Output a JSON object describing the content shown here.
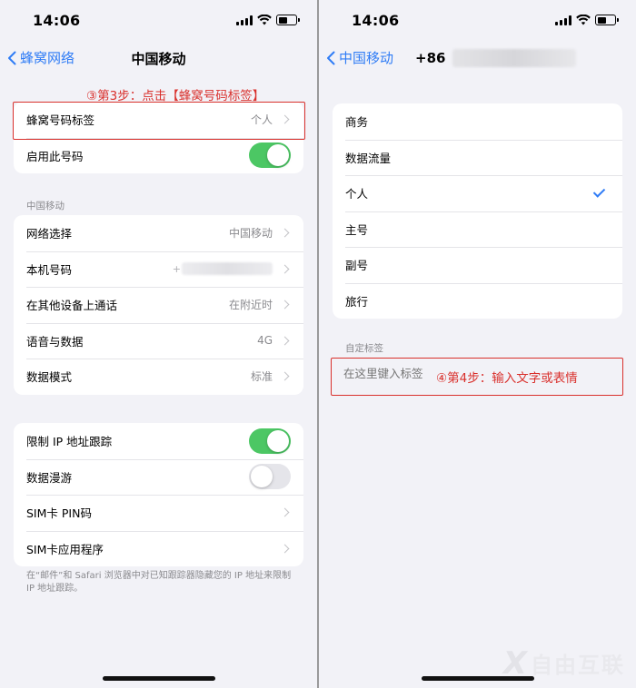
{
  "status_bar": {
    "time": "14:06"
  },
  "left": {
    "back_label": "蜂窝网络",
    "title": "中国移动",
    "annotation_step3": "③第3步：点击【蜂窝号码标签】",
    "group1": {
      "label_row": {
        "label": "蜂窝号码标签",
        "value": "个人"
      },
      "enable_row": {
        "label": "启用此号码",
        "toggle": "on"
      }
    },
    "carrier_section_header": "中国移动",
    "group2": [
      {
        "label": "网络选择",
        "value": "中国移动"
      },
      {
        "label": "本机号码",
        "value": "+"
      },
      {
        "label": "在其他设备上通话",
        "value": "在附近时"
      },
      {
        "label": "语音与数据",
        "value": "4G"
      },
      {
        "label": "数据模式",
        "value": "标准"
      }
    ],
    "group3": [
      {
        "label": "限制 IP 地址跟踪",
        "toggle": "on"
      },
      {
        "label": "数据漫游",
        "toggle": "off"
      },
      {
        "label": "SIM卡 PIN码"
      },
      {
        "label": "SIM卡应用程序"
      }
    ],
    "footnote": "在“邮件”和 Safari 浏览器中对已知跟踪器隐藏您的 IP 地址来限制 IP 地址跟踪。"
  },
  "right": {
    "back_label": "中国移动",
    "phone_prefix": "+86",
    "options": [
      {
        "label": "商务",
        "selected": false
      },
      {
        "label": "数据流量",
        "selected": false
      },
      {
        "label": "个人",
        "selected": true
      },
      {
        "label": "主号",
        "selected": false
      },
      {
        "label": "副号",
        "selected": false
      },
      {
        "label": "旅行",
        "selected": false
      }
    ],
    "custom_section_header": "自定标签",
    "custom_placeholder": "在这里键入标签",
    "annotation_step4": "④第4步：输入文字或表情"
  },
  "watermark": {
    "text": "自由互联"
  },
  "colors": {
    "accent": "#2f7cf6",
    "toggle_on": "#4cc764",
    "annotation": "#d9302c"
  }
}
